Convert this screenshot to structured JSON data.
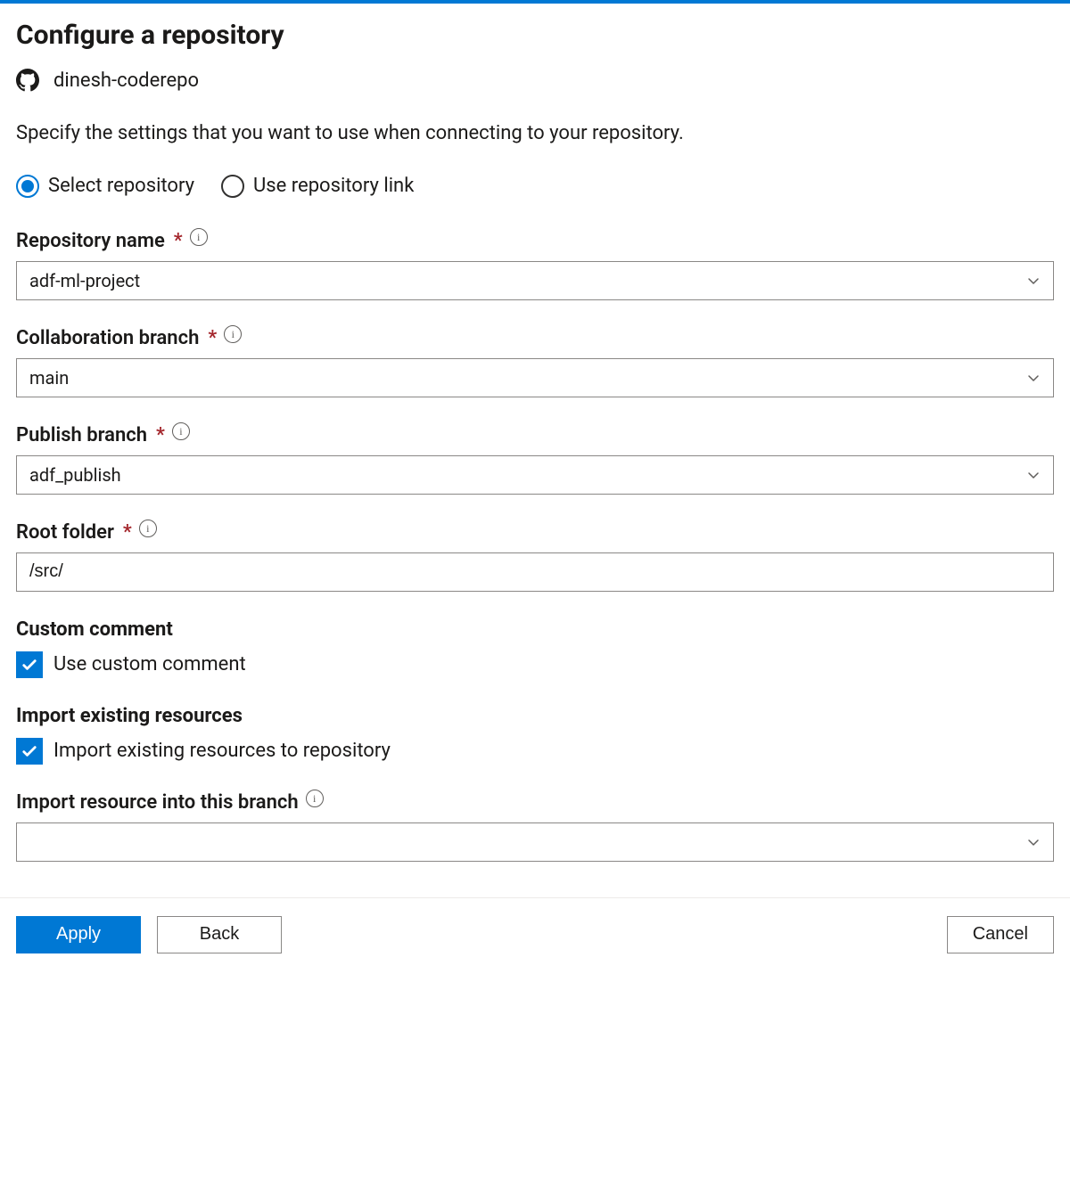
{
  "title": "Configure a repository",
  "account": {
    "name": "dinesh-coderepo"
  },
  "description": "Specify the settings that you want to use when connecting to your repository.",
  "mode": {
    "selected": "select",
    "options": {
      "select": "Select repository",
      "link": "Use repository link"
    }
  },
  "fields": {
    "repository_name": {
      "label": "Repository name",
      "value": "adf-ml-project"
    },
    "collaboration_branch": {
      "label": "Collaboration branch",
      "value": "main"
    },
    "publish_branch": {
      "label": "Publish branch",
      "value": "adf_publish"
    },
    "root_folder": {
      "label": "Root folder",
      "value": "/src/"
    },
    "import_branch": {
      "label": "Import resource into this branch",
      "value": ""
    }
  },
  "custom_comment": {
    "section_label": "Custom comment",
    "checkbox_label": "Use custom comment",
    "checked": true
  },
  "import_existing": {
    "section_label": "Import existing resources",
    "checkbox_label": "Import existing resources to repository",
    "checked": true
  },
  "buttons": {
    "apply": "Apply",
    "back": "Back",
    "cancel": "Cancel"
  }
}
